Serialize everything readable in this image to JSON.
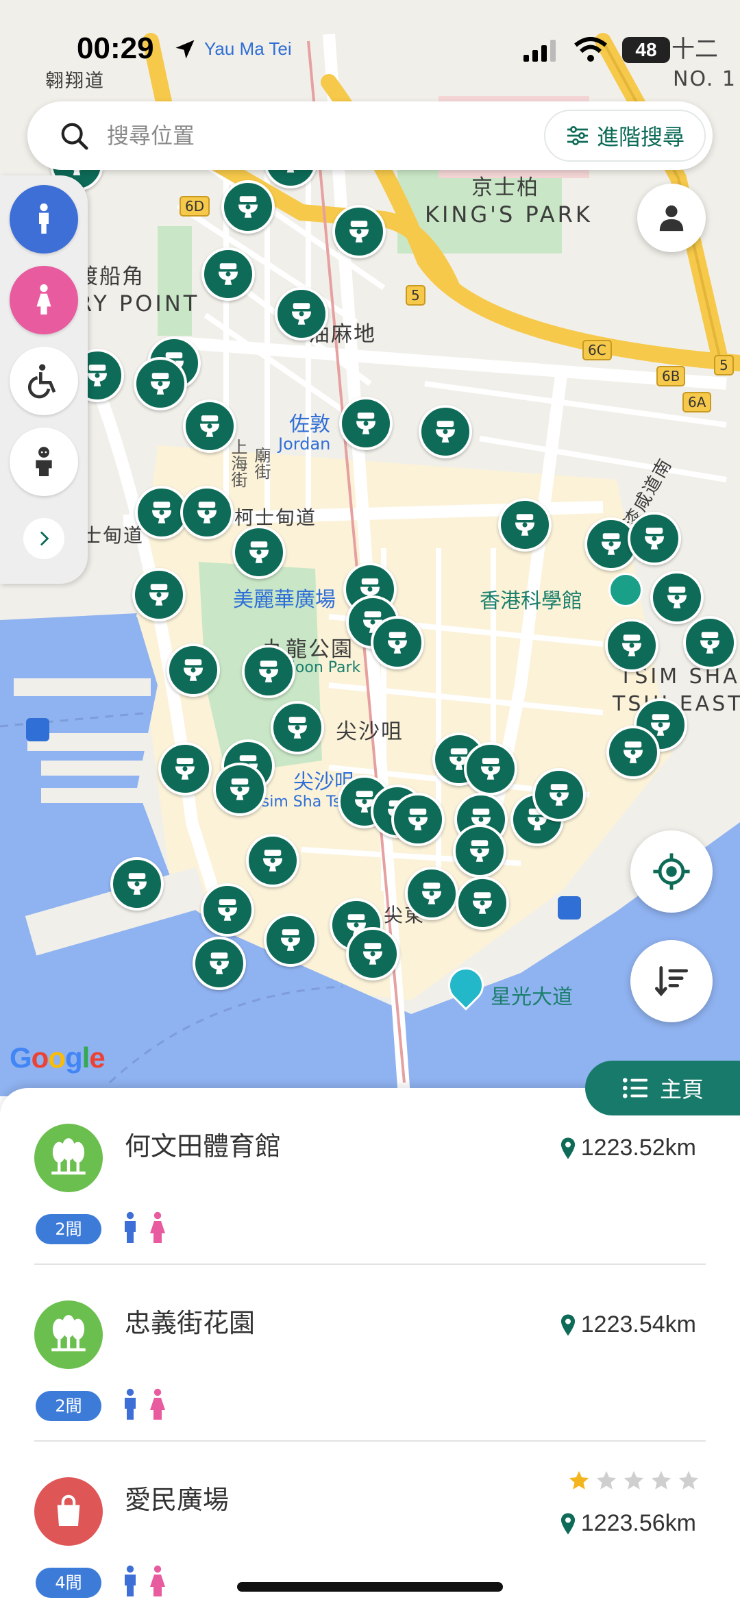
{
  "status_bar": {
    "time": "00:29",
    "location_name": "Yau Ma Tei",
    "battery": "48",
    "corner_label_1": "十二",
    "corner_label_2": "NO. 1"
  },
  "search": {
    "placeholder": "搜尋位置",
    "advanced_label": "進階搜尋"
  },
  "map": {
    "labels": {
      "kings_park_zh": "京士柏",
      "kings_park_en": "KING'S PARK",
      "ferry_point_zh": "渡船角",
      "ferry_point_en": "RY POINT",
      "yau_ma_tei_zh": "油麻地",
      "jordan_zh": "佐敦",
      "jordan_en": "Jordan",
      "austin_rd": "柯士甸道",
      "austin_rd_left": "士甸道",
      "science_museum": "香港科學館",
      "kowloon_park_zh": "九龍公園",
      "kowloon_park_en": "Kowloon Park",
      "mira_place": "美麗華廣場",
      "tst_zh": "尖沙咀",
      "tst_mtr_zh": "尖沙咀",
      "tst_mtr_en": "Tsim Sha Tsui",
      "tst_east_1": "TSIM SHA",
      "tst_east_2": "TSUI EAST",
      "avenue_stars": "星光大道",
      "chatham_rd": "漆咸道南",
      "shanghai_st": "上海街",
      "temple_st": "廟街",
      "yau_mong": "翱翔道",
      "east_station": "尖東"
    },
    "road_shields": [
      "6D",
      "5",
      "5",
      "6C",
      "6B",
      "6A"
    ],
    "google_logo": "Google"
  },
  "filters": {
    "male_icon": "male-icon",
    "female_icon": "female-icon",
    "accessible_icon": "wheelchair-icon",
    "baby_icon": "baby-icon",
    "more_icon": "chevron-right-icon"
  },
  "home_tab": {
    "label": "主頁"
  },
  "colors": {
    "brand_green": "#0d6b57",
    "tab_green": "#177a6b",
    "male_blue": "#3d6fd6",
    "female_pink": "#e85b9f",
    "park_green": "#6bbf4e",
    "mall_red": "#df5656",
    "count_blue": "#3d7bd9",
    "star_gold": "#f3b51d"
  },
  "list": [
    {
      "name": "何文田體育館",
      "distance": "1223.52km",
      "count": "2間",
      "icon": "park-trees-icon",
      "rating": null
    },
    {
      "name": "忠義街花園",
      "distance": "1223.54km",
      "count": "2間",
      "icon": "park-trees-icon",
      "rating": null
    },
    {
      "name": "愛民廣場",
      "distance": "1223.56km",
      "count": "4間",
      "icon": "shopping-bag-icon",
      "rating": 1,
      "rating_max": 5
    }
  ]
}
